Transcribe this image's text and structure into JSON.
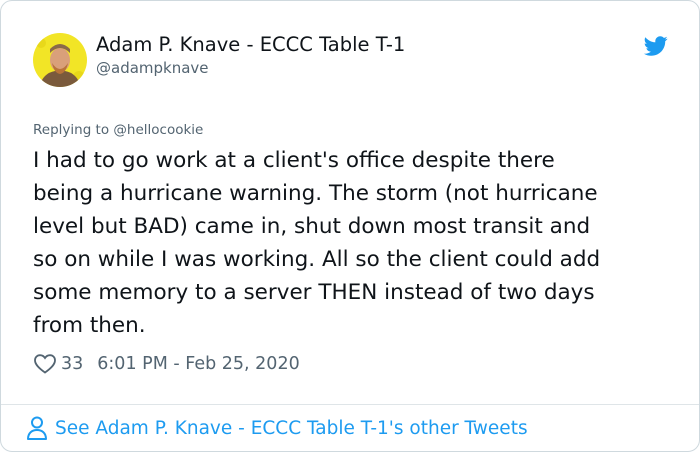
{
  "author": {
    "name": "Adam P. Knave - ECCC Table T-1",
    "handle": "@adampknave"
  },
  "reply": {
    "prefix": "Replying to ",
    "to": "@hellocookie"
  },
  "tweet": {
    "lines": [
      "I had to go work at a client's office despite there",
      "being a hurricane warning. The storm (not hurricane",
      "level but BAD) came in, shut down most transit and",
      "so on while I was working. All so the client could add",
      "some memory to a server THEN instead of two days",
      "from then."
    ],
    "likes": "33",
    "timestamp": "6:01 PM - Feb 25, 2020"
  },
  "footer": {
    "label": "See Adam P. Knave - ECCC Table T-1's other Tweets"
  },
  "icons": {
    "brand": "twitter-bird-icon",
    "like": "heart-icon",
    "profile": "person-icon"
  },
  "colors": {
    "accent": "#1d9bf0",
    "text": "#0f1419",
    "muted": "#536471",
    "border": "#cfd9de",
    "avatar_bg": "#f2e526"
  }
}
